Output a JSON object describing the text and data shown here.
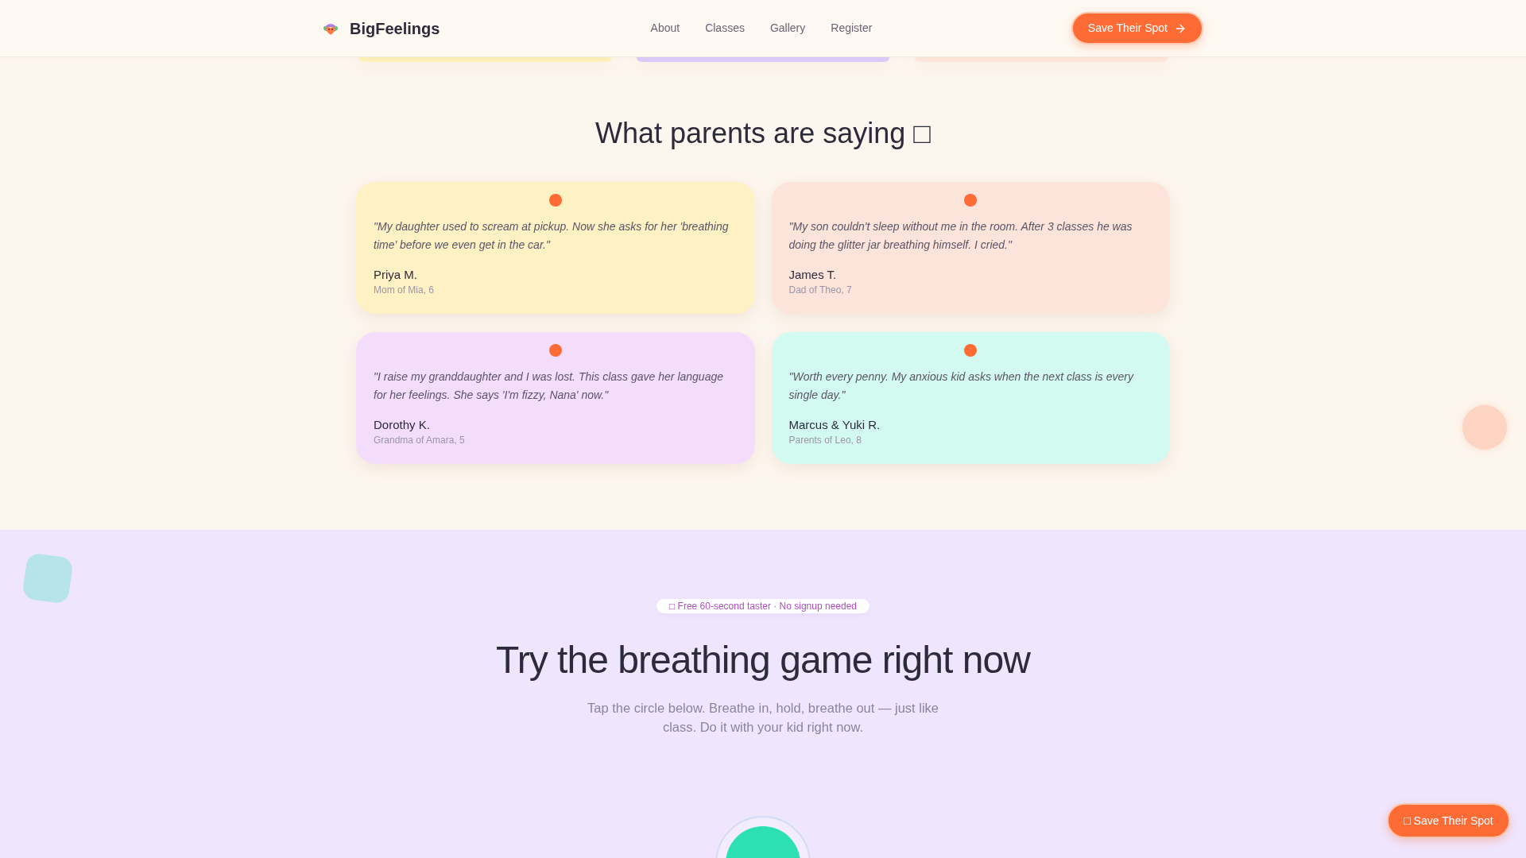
{
  "header": {
    "brand": "BigFeelings",
    "nav": [
      {
        "label": "About"
      },
      {
        "label": "Classes"
      },
      {
        "label": "Gallery"
      },
      {
        "label": "Register"
      }
    ],
    "cta": "Save Their Spot"
  },
  "previous_cards": [
    {
      "color": "#fdf0b8"
    },
    {
      "color": "#dccbfa"
    },
    {
      "color": "#fde6da"
    }
  ],
  "testimonials": {
    "title": "What parents are saying □",
    "items": [
      {
        "quote": "\"My daughter used to scream at pickup. Now she asks for her 'breathing time' before we even get in the car.\"",
        "name": "Priya M.",
        "relation": "Mom of Mia, 6",
        "color": "#fef1c4"
      },
      {
        "quote": "\"My son couldn't sleep without me in the room. After 3 classes he was doing the glitter jar breathing himself. I cried.\"",
        "name": "James T.",
        "relation": "Dad of Theo, 7",
        "color": "#fde4da"
      },
      {
        "quote": "\"I raise my granddaughter and I was lost. This class gave her language for her feelings. She says 'I'm fizzy, Nana' now.\"",
        "name": "Dorothy K.",
        "relation": "Grandma of Amara, 5",
        "color": "#f4ddfc"
      },
      {
        "quote": "\"Worth every penny. My anxious kid asks when the next class is every single day.\"",
        "name": "Marcus & Yuki R.",
        "relation": "Parents of Leo, 8",
        "color": "#d3faf0"
      }
    ]
  },
  "breathing": {
    "badge": "□ Free 60-second taster · No signup needed",
    "title": "Try the breathing game right now",
    "subtitle": "Tap the circle below. Breathe in, hold, breathe out — just like class. Do it with your kid right now."
  },
  "floating_button": "□ Save Their Spot"
}
